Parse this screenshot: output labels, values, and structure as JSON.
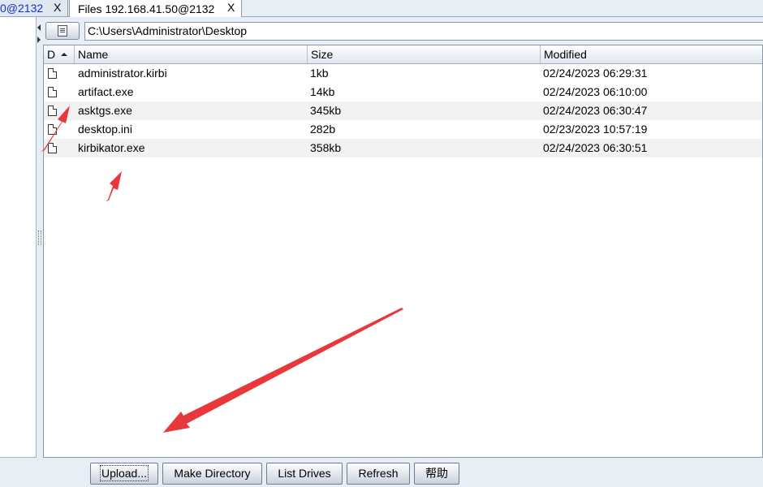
{
  "tabs": [
    {
      "label": "0@2132",
      "close": "X"
    },
    {
      "label": "Files 192.168.41.50@2132",
      "close": "X"
    }
  ],
  "path": {
    "value": "C:\\Users\\Administrator\\Desktop"
  },
  "table": {
    "headers": {
      "d": "D",
      "name": "Name",
      "size": "Size",
      "modified": "Modified"
    },
    "rows": [
      {
        "name": "administrator.kirbi",
        "size": "1kb",
        "modified": "02/24/2023 06:29:31"
      },
      {
        "name": "artifact.exe",
        "size": "14kb",
        "modified": "02/24/2023 06:10:00"
      },
      {
        "name": "asktgs.exe",
        "size": "345kb",
        "modified": "02/24/2023 06:30:47"
      },
      {
        "name": "desktop.ini",
        "size": "282b",
        "modified": "02/23/2023 10:57:19"
      },
      {
        "name": "kirbikator.exe",
        "size": "358kb",
        "modified": "02/24/2023 06:30:51"
      }
    ]
  },
  "buttons": {
    "upload": "Upload...",
    "make_directory": "Make Directory",
    "list_drives": "List Drives",
    "refresh": "Refresh",
    "help": "帮助"
  },
  "colors": {
    "annotation": "#e8383b",
    "tab_link": "#1b2fc4"
  },
  "icons": [
    "file-icon",
    "browse-icon",
    "sort-ascending-icon",
    "close-icon"
  ]
}
